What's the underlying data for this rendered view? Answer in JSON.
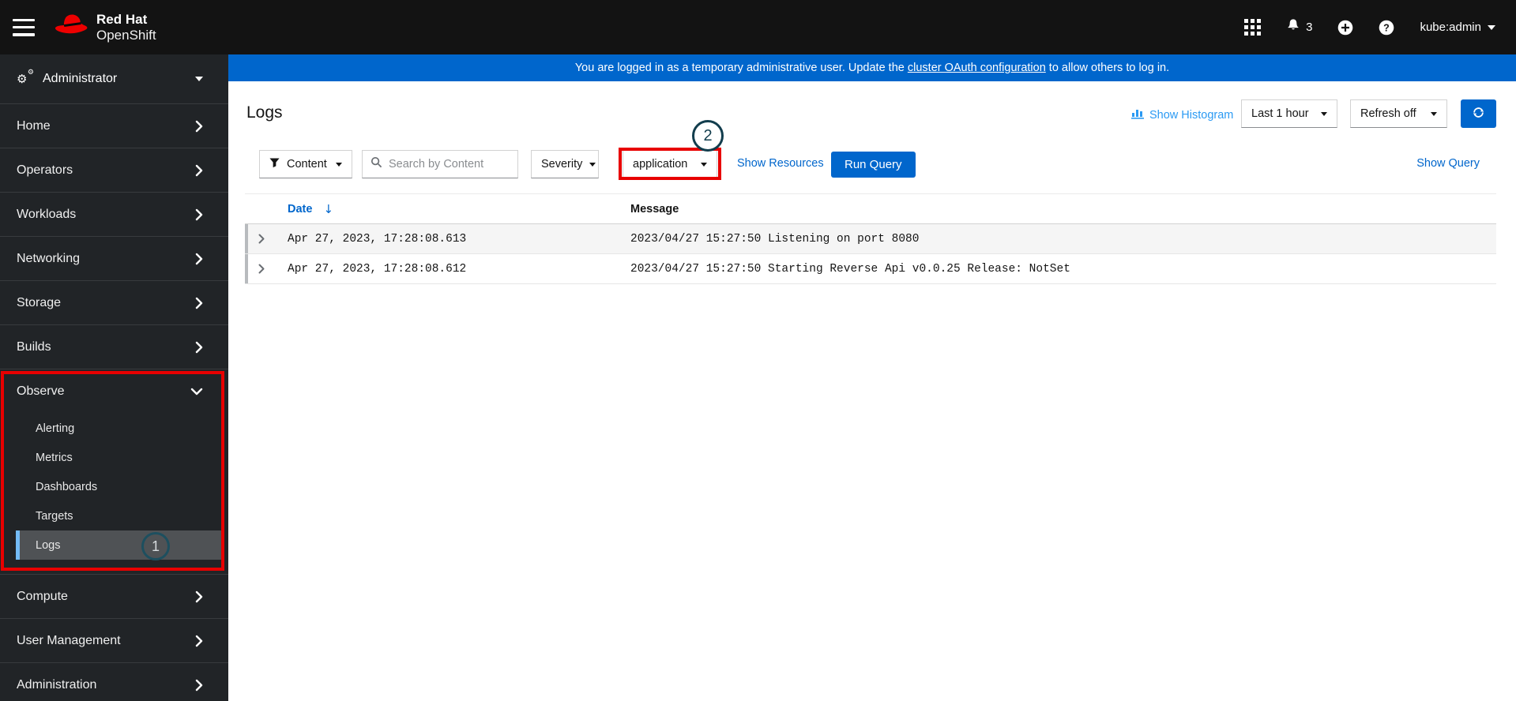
{
  "masthead": {
    "brand_top": "Red Hat",
    "brand_bottom": "OpenShift",
    "notification_count": "3",
    "user_label": "kube:admin"
  },
  "banner": {
    "prefix": "You are logged in as a temporary administrative user. Update the ",
    "link_text": "cluster OAuth configuration",
    "suffix": " to allow others to log in."
  },
  "sidebar": {
    "perspective": {
      "label": "Administrator"
    },
    "items": [
      {
        "label": "Home"
      },
      {
        "label": "Operators"
      },
      {
        "label": "Workloads"
      },
      {
        "label": "Networking"
      },
      {
        "label": "Storage"
      },
      {
        "label": "Builds"
      }
    ],
    "observe": {
      "label": "Observe",
      "children": [
        {
          "label": "Alerting"
        },
        {
          "label": "Metrics"
        },
        {
          "label": "Dashboards"
        },
        {
          "label": "Targets"
        },
        {
          "label": "Logs",
          "selected": true
        }
      ]
    },
    "bottom_items": [
      {
        "label": "Compute"
      },
      {
        "label": "User Management"
      },
      {
        "label": "Administration"
      }
    ]
  },
  "page": {
    "title": "Logs",
    "toolbar": {
      "show_histogram": "Show Histogram",
      "time_range": "Last 1 hour",
      "refresh_interval": "Refresh off"
    },
    "filter_bar": {
      "attribute_dropdown": "Content",
      "search_placeholder": "Search by Content",
      "severity_dropdown": "Severity",
      "tenant_dropdown": "application",
      "show_resources": "Show Resources",
      "run_query": "Run Query",
      "show_query": "Show Query"
    }
  },
  "log_table": {
    "columns": {
      "date": "Date",
      "message": "Message"
    },
    "sort_icon": "↓",
    "rows": [
      {
        "date": "Apr 27, 2023, 17:28:08.613",
        "message": "2023/04/27 15:27:50 Listening on port 8080"
      },
      {
        "date": "Apr 27, 2023, 17:28:08.612",
        "message": "2023/04/27 15:27:50 Starting Reverse Api v0.0.25 Release: NotSet"
      }
    ]
  },
  "annotations": {
    "step_1": "1",
    "step_2": "2",
    "box_color": "#e80000",
    "circle_color": "#1d4f5f"
  },
  "colors": {
    "masthead_bg": "#131313",
    "sidebar_bg": "#212427",
    "banner_bg": "#0066cc",
    "primary": "#0066cc",
    "link": "#0066cc",
    "histogram_link": "#2b9af3",
    "selected_nav_bg": "#4f5255",
    "selected_nav_bar": "#73bcf7",
    "row_stripe": "#f5f5f5"
  }
}
